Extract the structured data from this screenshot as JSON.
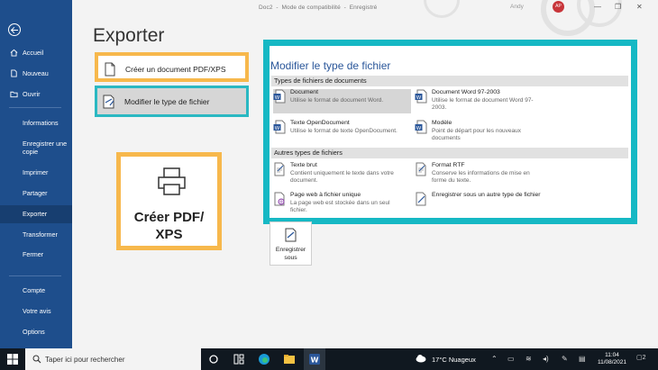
{
  "titlebar": {
    "document": "Doc2",
    "mode": "Mode de compatibilité",
    "status": "Enregistré",
    "user": "Andy",
    "avatar_initials": "AP"
  },
  "nav": {
    "items": [
      {
        "label": "Accueil",
        "icon": "home-icon"
      },
      {
        "label": "Nouveau",
        "icon": "new-document-icon"
      },
      {
        "label": "Ouvrir",
        "icon": "folder-open-icon"
      },
      {
        "label": "Informations"
      },
      {
        "label": "Enregistrer une copie"
      },
      {
        "label": "Imprimer"
      },
      {
        "label": "Partager"
      },
      {
        "label": "Exporter",
        "active": true
      },
      {
        "label": "Transformer"
      },
      {
        "label": "Fermer"
      },
      {
        "label": "Compte"
      },
      {
        "label": "Votre avis"
      },
      {
        "label": "Options"
      }
    ]
  },
  "page_title": "Exporter",
  "options": {
    "pdf": "Créer un document PDF/XPS",
    "change_type": "Modifier le type de fichier"
  },
  "big_button": {
    "line1": "Créer PDF/",
    "line2": "XPS"
  },
  "panel": {
    "title": "Modifier le type de fichier",
    "section_documents": "Types de fichiers de documents",
    "section_other": "Autres types de fichiers",
    "documents": [
      {
        "name": "Document",
        "desc": "Utilise le format de document Word.",
        "icon": "word-doc-icon",
        "selected": true
      },
      {
        "name": "Document Word 97-2003",
        "desc": "Utilise le format de document Word 97-2003.",
        "icon": "word-97-doc-icon"
      },
      {
        "name": "Texte OpenDocument",
        "desc": "Utilise le format de texte OpenDocument.",
        "icon": "odt-doc-icon"
      },
      {
        "name": "Modèle",
        "desc": "Point de départ pour les nouveaux documents",
        "icon": "word-template-icon"
      }
    ],
    "other": [
      {
        "name": "Texte brut",
        "desc": "Contient uniquement le texte dans votre document.",
        "icon": "plain-text-icon"
      },
      {
        "name": "Format RTF",
        "desc": "Conserve les informations de mise en forme du texte.",
        "icon": "rtf-doc-icon"
      },
      {
        "name": "Page web à fichier unique",
        "desc": "La page web est stockée dans un seul fichier.",
        "icon": "single-file-web-icon"
      },
      {
        "name": "Enregistrer sous un autre type de fichier",
        "desc": "",
        "icon": "other-file-type-icon"
      }
    ]
  },
  "save_as": {
    "line1": "Enregistrer",
    "line2": "sous"
  },
  "taskbar": {
    "search_placeholder": "Taper ici pour rechercher",
    "weather": "17°C Nuageux",
    "time": "11:04",
    "date": "11/08/2021",
    "notifications": "2"
  },
  "colors": {
    "nav_bg": "#1e4e8c",
    "accent_orange": "#f7b84c",
    "accent_teal": "#16b8c4",
    "panel_title": "#2b579a"
  }
}
